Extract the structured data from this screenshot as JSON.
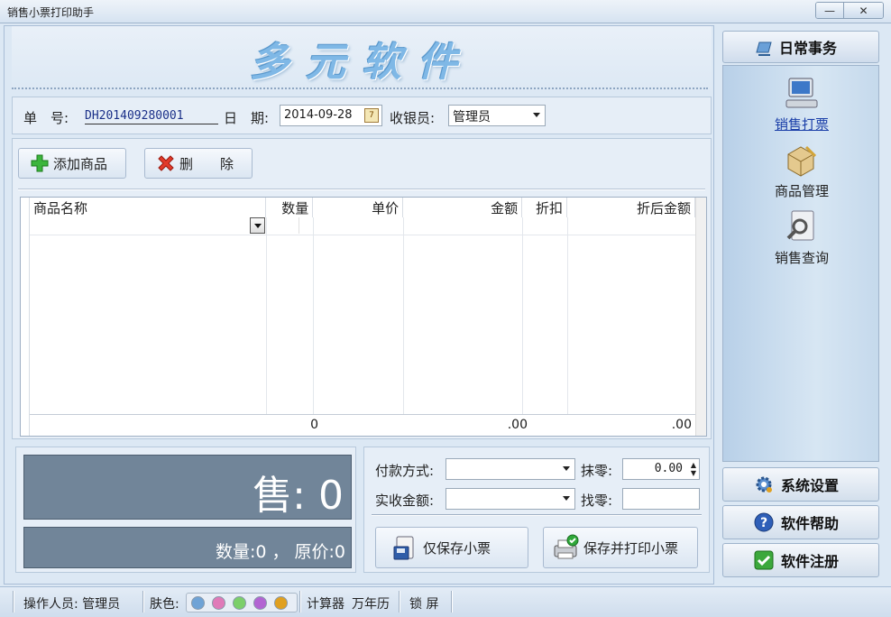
{
  "window": {
    "title": "销售小票打印助手",
    "minimize": "—",
    "close": "✕"
  },
  "banner": {
    "logo_text": "多元软件"
  },
  "header": {
    "order_label": "单　号:",
    "order_no": "DH201409280001",
    "date_label": "日　期:",
    "date_value": "2014-09-28",
    "calendar_glyph": "7",
    "cashier_label": "收银员:",
    "cashier_value": "管理员"
  },
  "toolbar": {
    "add_label": "添加商品",
    "delete_label": "删　　除"
  },
  "grid": {
    "columns": [
      "商品名称",
      "数量",
      "单价",
      "金额",
      "折扣",
      "折后金额"
    ],
    "totals": {
      "quantity": "0",
      "amount": ".00",
      "discounted_amount": ".00"
    }
  },
  "summary": {
    "sale_text": "售: 0",
    "qty_text": "数量:0 ， 原价:0"
  },
  "payment": {
    "method_label": "付款方式:",
    "method_value": "",
    "round_label": "抹零:",
    "round_value": "0.00",
    "received_label": "实收金额:",
    "received_value": "",
    "change_label": "找零:",
    "change_value": "",
    "save_label": "仅保存小票",
    "save_print_label": "保存并打印小票"
  },
  "sidebar": {
    "header": "日常事务",
    "items": [
      {
        "label": "销售打票",
        "icon": "computer-icon",
        "active": true
      },
      {
        "label": "商品管理",
        "icon": "box-icon",
        "active": false
      },
      {
        "label": "销售查询",
        "icon": "search-doc-icon",
        "active": false
      }
    ],
    "buttons": [
      {
        "label": "系统设置",
        "icon": "gear-icon"
      },
      {
        "label": "软件帮助",
        "icon": "help-icon"
      },
      {
        "label": "软件注册",
        "icon": "register-icon"
      }
    ]
  },
  "status": {
    "operator": "操作人员: 管理员",
    "skin_label": "肤色:",
    "skin_colors": [
      "#6fa3d6",
      "#e07ab8",
      "#7ccf6a",
      "#b264d2",
      "#e0a020"
    ],
    "calculator": "计算器",
    "calendar": "万年历",
    "lock": "锁 屏"
  }
}
